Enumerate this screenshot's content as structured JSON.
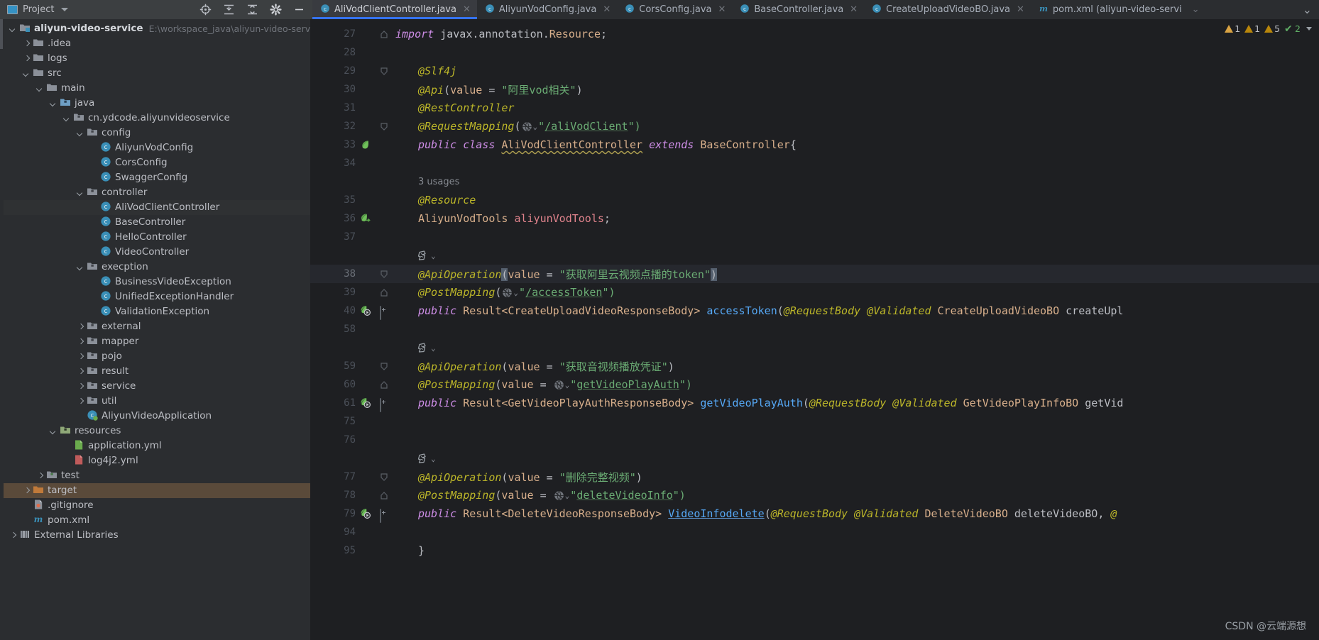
{
  "toolwindow": {
    "title": "Project",
    "icons": [
      "locate-icon",
      "expand-all-icon",
      "collapse-all-icon",
      "settings-gear-icon",
      "minimize-icon"
    ]
  },
  "tabs": [
    {
      "label": "AliVodClientController.java",
      "icon": "java-class-icon",
      "active": true
    },
    {
      "label": "AliyunVodConfig.java",
      "icon": "java-class-icon",
      "active": false
    },
    {
      "label": "CorsConfig.java",
      "icon": "java-class-icon",
      "active": false
    },
    {
      "label": "BaseController.java",
      "icon": "java-class-icon",
      "active": false
    },
    {
      "label": "CreateUploadVideoBO.java",
      "icon": "java-class-icon",
      "active": false
    },
    {
      "label": "pom.xml (aliyun-video-servi",
      "icon": "maven-icon",
      "active": false
    }
  ],
  "project_tree": [
    {
      "depth": 0,
      "arrow": "open",
      "icon": "module-icon",
      "label": "aliyun-video-service",
      "bold": true,
      "path": "E:\\workspace_java\\aliyun-video-service"
    },
    {
      "depth": 1,
      "arrow": "closed",
      "icon": "folder-icon",
      "label": ".idea"
    },
    {
      "depth": 1,
      "arrow": "closed",
      "icon": "folder-icon",
      "label": "logs"
    },
    {
      "depth": 1,
      "arrow": "open",
      "icon": "folder-icon",
      "label": "src"
    },
    {
      "depth": 2,
      "arrow": "open",
      "icon": "folder-icon",
      "label": "main"
    },
    {
      "depth": 3,
      "arrow": "open",
      "icon": "source-root-icon",
      "label": "java"
    },
    {
      "depth": 4,
      "arrow": "open",
      "icon": "package-icon",
      "label": "cn.ydcode.aliyunvideoservice"
    },
    {
      "depth": 5,
      "arrow": "open",
      "icon": "package-icon",
      "label": "config"
    },
    {
      "depth": 6,
      "arrow": "none",
      "icon": "class-icon",
      "label": "AliyunVodConfig"
    },
    {
      "depth": 6,
      "arrow": "none",
      "icon": "class-icon",
      "label": "CorsConfig"
    },
    {
      "depth": 6,
      "arrow": "none",
      "icon": "class-icon",
      "label": "SwaggerConfig"
    },
    {
      "depth": 5,
      "arrow": "open",
      "icon": "package-icon",
      "label": "controller"
    },
    {
      "depth": 6,
      "arrow": "none",
      "icon": "class-icon",
      "label": "AliVodClientController",
      "selected": true
    },
    {
      "depth": 6,
      "arrow": "none",
      "icon": "class-icon",
      "label": "BaseController"
    },
    {
      "depth": 6,
      "arrow": "none",
      "icon": "class-icon",
      "label": "HelloController"
    },
    {
      "depth": 6,
      "arrow": "none",
      "icon": "class-icon",
      "label": "VideoController"
    },
    {
      "depth": 5,
      "arrow": "open",
      "icon": "package-icon",
      "label": "execption"
    },
    {
      "depth": 6,
      "arrow": "none",
      "icon": "class-icon",
      "label": "BusinessVideoException"
    },
    {
      "depth": 6,
      "arrow": "none",
      "icon": "class-icon",
      "label": "UnifiedExceptionHandler"
    },
    {
      "depth": 6,
      "arrow": "none",
      "icon": "class-icon",
      "label": "ValidationException"
    },
    {
      "depth": 5,
      "arrow": "closed",
      "icon": "package-icon",
      "label": "external"
    },
    {
      "depth": 5,
      "arrow": "closed",
      "icon": "package-icon",
      "label": "mapper"
    },
    {
      "depth": 5,
      "arrow": "closed",
      "icon": "package-icon",
      "label": "pojo"
    },
    {
      "depth": 5,
      "arrow": "closed",
      "icon": "package-icon",
      "label": "result"
    },
    {
      "depth": 5,
      "arrow": "closed",
      "icon": "package-icon",
      "label": "service"
    },
    {
      "depth": 5,
      "arrow": "closed",
      "icon": "package-icon",
      "label": "util"
    },
    {
      "depth": 5,
      "arrow": "none",
      "icon": "spring-class-icon",
      "label": "AliyunVideoApplication"
    },
    {
      "depth": 3,
      "arrow": "open",
      "icon": "resource-root-icon",
      "label": "resources"
    },
    {
      "depth": 4,
      "arrow": "none",
      "icon": "yml-icon",
      "label": "application.yml"
    },
    {
      "depth": 4,
      "arrow": "none",
      "icon": "xml-red-icon",
      "label": "log4j2.yml"
    },
    {
      "depth": 2,
      "arrow": "closed",
      "icon": "test-root-icon",
      "label": "test"
    },
    {
      "depth": 1,
      "arrow": "closed",
      "icon": "target-folder-icon",
      "label": "target",
      "highlight": true
    },
    {
      "depth": 1,
      "arrow": "none",
      "icon": "git-icon",
      "label": ".gitignore"
    },
    {
      "depth": 1,
      "arrow": "none",
      "icon": "maven-icon",
      "label": "pom.xml"
    },
    {
      "depth": 0,
      "arrow": "closed",
      "icon": "library-icon",
      "label": "External Libraries"
    }
  ],
  "inspections": {
    "warnings_1": "1",
    "warnings_2": "1",
    "weak_warnings": "5",
    "ok_marks": "2"
  },
  "code": {
    "lines": [
      {
        "num": "27",
        "fold": "fold-end",
        "segments": [
          {
            "t": "import ",
            "c": "kw"
          },
          {
            "t": "javax.annotation.",
            "c": "pln"
          },
          {
            "t": "Resource",
            "c": "typ-italic"
          },
          {
            "t": ";",
            "c": "pln"
          }
        ]
      },
      {
        "num": "28",
        "segments": []
      },
      {
        "num": "29",
        "fold": "fold-start",
        "segments": [
          {
            "t": "@Slf4j",
            "c": "ann"
          }
        ]
      },
      {
        "num": "30",
        "segments": [
          {
            "t": "@Api",
            "c": "ann"
          },
          {
            "t": "(",
            "c": "pln"
          },
          {
            "t": "value",
            "c": "typ"
          },
          {
            "t": " = ",
            "c": "pln"
          },
          {
            "t": "\"阿里vod相关\"",
            "c": "str"
          },
          {
            "t": ")",
            "c": "pln"
          }
        ]
      },
      {
        "num": "31",
        "segments": [
          {
            "t": "@RestController",
            "c": "ann"
          }
        ]
      },
      {
        "num": "32",
        "fold": "fold-start",
        "segments": [
          {
            "t": "@RequestMapping",
            "c": "ann"
          },
          {
            "t": "(",
            "c": "pln"
          },
          {
            "t": "GLOBE",
            "c": "globe"
          },
          {
            "t": "\"",
            "c": "str"
          },
          {
            "t": "/aliVodClient",
            "c": "str-ul"
          },
          {
            "t": "\")",
            "c": "str"
          }
        ]
      },
      {
        "num": "33",
        "gutter": "bean-icon",
        "segments": [
          {
            "t": "public class ",
            "c": "kw"
          },
          {
            "t": "AliVodClientController",
            "c": "typ-wavy"
          },
          {
            "t": " extends ",
            "c": "kw"
          },
          {
            "t": "BaseController",
            "c": "typ"
          },
          {
            "t": "{",
            "c": "pln"
          }
        ]
      },
      {
        "num": "34",
        "segments": []
      },
      {
        "num": "",
        "hint": "3 usages"
      },
      {
        "num": "35",
        "segments": [
          {
            "t": "@Resource",
            "c": "ann"
          }
        ]
      },
      {
        "num": "36",
        "gutter": "bean-arrow-icon",
        "segments": [
          {
            "t": "AliyunVodTools",
            "c": "typ"
          },
          {
            "t": " ",
            "c": "pln"
          },
          {
            "t": "aliyunVodTools",
            "c": "fld"
          },
          {
            "t": ";",
            "c": "pln"
          }
        ]
      },
      {
        "num": "37",
        "segments": []
      },
      {
        "num": "",
        "endpoint": true
      },
      {
        "num": "38",
        "current": true,
        "fold": "fold-start",
        "segments": [
          {
            "t": "@ApiOperation",
            "c": "ann"
          },
          {
            "t": "(",
            "c": "paren-hl"
          },
          {
            "t": "value",
            "c": "typ"
          },
          {
            "t": " = ",
            "c": "pln"
          },
          {
            "t": "\"获取阿里云视频点播的token\"",
            "c": "str"
          },
          {
            "t": ")",
            "c": "paren-hl"
          }
        ]
      },
      {
        "num": "39",
        "fold": "fold-end",
        "segments": [
          {
            "t": "@PostMapping",
            "c": "ann"
          },
          {
            "t": "(",
            "c": "pln"
          },
          {
            "t": "GLOBE",
            "c": "globe"
          },
          {
            "t": "\"",
            "c": "str"
          },
          {
            "t": "/accessToken",
            "c": "str-ul"
          },
          {
            "t": "\")",
            "c": "str"
          }
        ]
      },
      {
        "num": "40",
        "gutter": "bean-run-icon",
        "fold": "plus",
        "segments": [
          {
            "t": "public ",
            "c": "kw"
          },
          {
            "t": "Result<CreateUploadVideoResponseBody>",
            "c": "typ"
          },
          {
            "t": " ",
            "c": "pln"
          },
          {
            "t": "accessToken",
            "c": "mth"
          },
          {
            "t": "(",
            "c": "pln"
          },
          {
            "t": "@RequestBody @Validated",
            "c": "ann"
          },
          {
            "t": " ",
            "c": "pln"
          },
          {
            "t": "CreateUploadVideoBO",
            "c": "typ"
          },
          {
            "t": " ",
            "c": "pln"
          },
          {
            "t": "createUpl",
            "c": "pln"
          }
        ]
      },
      {
        "num": "58",
        "segments": []
      },
      {
        "num": "",
        "endpoint": true
      },
      {
        "num": "59",
        "fold": "fold-start",
        "segments": [
          {
            "t": "@ApiOperation",
            "c": "ann"
          },
          {
            "t": "(",
            "c": "pln"
          },
          {
            "t": "value",
            "c": "typ"
          },
          {
            "t": " = ",
            "c": "pln"
          },
          {
            "t": "\"获取音视频播放凭证\"",
            "c": "str"
          },
          {
            "t": ")",
            "c": "pln"
          }
        ]
      },
      {
        "num": "60",
        "fold": "fold-end",
        "segments": [
          {
            "t": "@PostMapping",
            "c": "ann"
          },
          {
            "t": "(",
            "c": "pln"
          },
          {
            "t": "value",
            "c": "typ"
          },
          {
            "t": " = ",
            "c": "pln"
          },
          {
            "t": "GLOBE",
            "c": "globe"
          },
          {
            "t": "\"",
            "c": "str"
          },
          {
            "t": "getVideoPlayAuth",
            "c": "str-ul"
          },
          {
            "t": "\")",
            "c": "str"
          }
        ]
      },
      {
        "num": "61",
        "gutter": "bean-run-icon",
        "fold": "plus",
        "segments": [
          {
            "t": "public ",
            "c": "kw"
          },
          {
            "t": "Result<GetVideoPlayAuthResponseBody>",
            "c": "typ"
          },
          {
            "t": " ",
            "c": "pln"
          },
          {
            "t": "getVideoPlayAuth",
            "c": "mth"
          },
          {
            "t": "(",
            "c": "pln"
          },
          {
            "t": "@RequestBody @Validated",
            "c": "ann"
          },
          {
            "t": " ",
            "c": "pln"
          },
          {
            "t": "GetVideoPlayInfoBO",
            "c": "typ"
          },
          {
            "t": " ",
            "c": "pln"
          },
          {
            "t": "getVid",
            "c": "pln"
          }
        ]
      },
      {
        "num": "75",
        "segments": []
      },
      {
        "num": "76",
        "segments": []
      },
      {
        "num": "",
        "endpoint": true
      },
      {
        "num": "77",
        "fold": "fold-start",
        "segments": [
          {
            "t": "@ApiOperation",
            "c": "ann"
          },
          {
            "t": "(",
            "c": "pln"
          },
          {
            "t": "value",
            "c": "typ"
          },
          {
            "t": " = ",
            "c": "pln"
          },
          {
            "t": "\"删除完整视频\"",
            "c": "str"
          },
          {
            "t": ")",
            "c": "pln"
          }
        ]
      },
      {
        "num": "78",
        "fold": "fold-end",
        "segments": [
          {
            "t": "@PostMapping",
            "c": "ann"
          },
          {
            "t": "(",
            "c": "pln"
          },
          {
            "t": "value",
            "c": "typ"
          },
          {
            "t": " = ",
            "c": "pln"
          },
          {
            "t": "GLOBE",
            "c": "globe"
          },
          {
            "t": "\"",
            "c": "str"
          },
          {
            "t": "deleteVideoInfo",
            "c": "str-ul"
          },
          {
            "t": "\")",
            "c": "str"
          }
        ]
      },
      {
        "num": "79",
        "gutter": "bean-run-icon",
        "fold": "plus",
        "segments": [
          {
            "t": "public ",
            "c": "kw"
          },
          {
            "t": "Result<DeleteVideoResponseBody>",
            "c": "typ"
          },
          {
            "t": " ",
            "c": "pln"
          },
          {
            "t": "VideoInfodelete",
            "c": "mth-ul"
          },
          {
            "t": "(",
            "c": "pln"
          },
          {
            "t": "@RequestBody @Validated",
            "c": "ann"
          },
          {
            "t": " ",
            "c": "pln"
          },
          {
            "t": "DeleteVideoBO",
            "c": "typ"
          },
          {
            "t": " ",
            "c": "pln"
          },
          {
            "t": "deleteVideoBO",
            "c": "pln"
          },
          {
            "t": ", ",
            "c": "pln"
          },
          {
            "t": "@",
            "c": "ann"
          }
        ]
      },
      {
        "num": "94",
        "segments": []
      },
      {
        "num": "95",
        "segments": [
          {
            "t": "}",
            "c": "pln"
          }
        ]
      }
    ]
  },
  "watermark": "CSDN @云端源想"
}
